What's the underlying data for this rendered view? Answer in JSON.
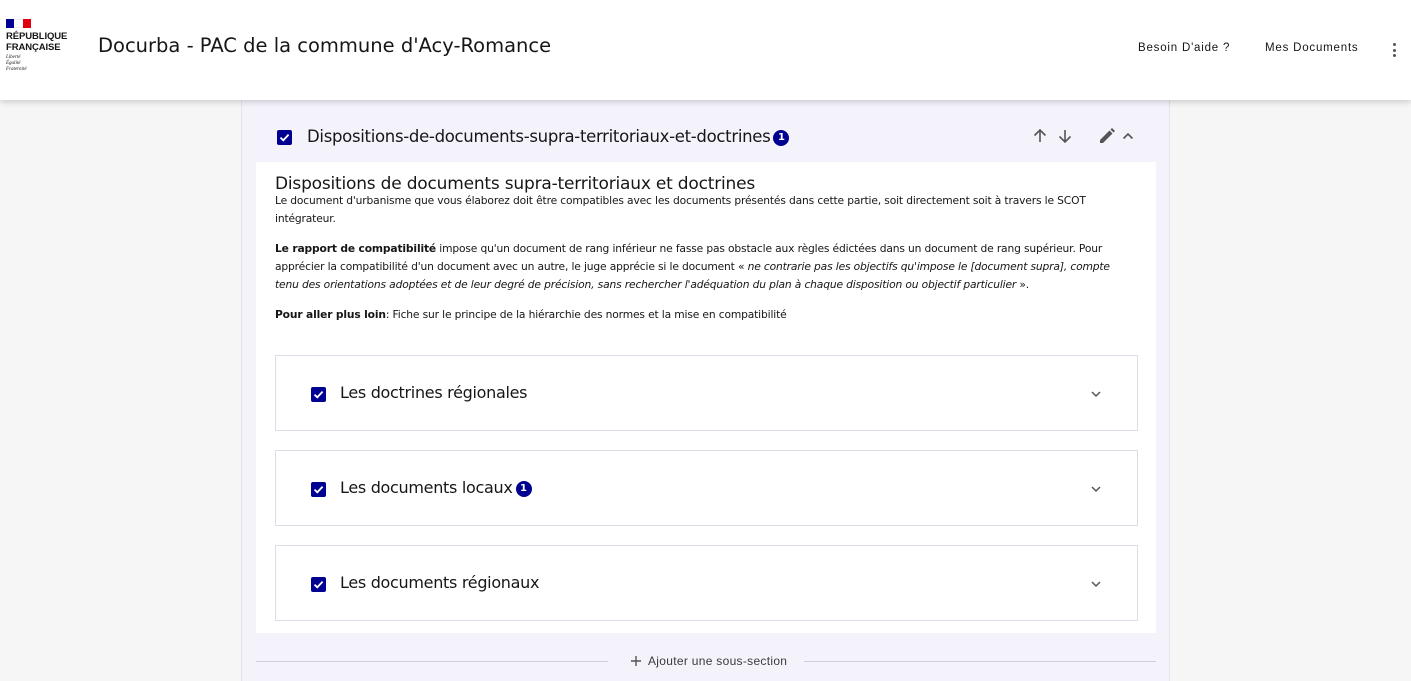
{
  "header": {
    "logo_lines": [
      "RÉPUBLIQUE",
      "FRANÇAISE"
    ],
    "logo_motto": [
      "Liberté",
      "Égalité",
      "Fraternité"
    ],
    "app_title": "Docurba - PAC de la commune d'Acy-Romance",
    "help_link": "Besoin D'aide ?",
    "documents_link": "Mes Documents",
    "menu_icon": "dots-vertical-icon"
  },
  "section": {
    "title": "Dispositions-de-documents-supra-territoriaux-et-doctrines",
    "badge": "1",
    "checked": true,
    "actions": [
      "arrow-up-icon",
      "arrow-down-icon",
      "pencil-icon",
      "chevron-up-icon"
    ]
  },
  "content": {
    "heading": "Dispositions de documents supra-territoriaux et doctrines",
    "intro": "Le document d'urbanisme que vous élaborez doit être compatibles avec les documents présentés dans cette partie, soit directement soit à travers le SCOT intégrateur.",
    "compat_label": "Le rapport de compatibilité",
    "compat_text": " impose qu'un document de rang inférieur ne fasse pas obstacle aux règles édictées dans un document de rang supérieur. Pour apprécier la compatibilité d'un document avec un autre, le juge apprécie si le document « ",
    "compat_quote": "ne contrarie pas les objectifs qu'impose le [document supra], compte tenu des orientations adoptées et de leur degré de précision, sans rechercher l'adéquation du plan à chaque disposition ou objectif particulier",
    "compat_end": " ».",
    "further_label": "Pour aller plus loin",
    "further_text": ": Fiche sur le principe de la hiérarchie des normes et la mise en compatibilité"
  },
  "subsections": [
    {
      "title": "Les doctrines régionales",
      "badge": "",
      "checked": true
    },
    {
      "title": "Les documents locaux",
      "badge": "1",
      "checked": true
    },
    {
      "title": "Les documents régionaux",
      "badge": "",
      "checked": true
    }
  ],
  "add_subsection_label": "Ajouter une sous-section",
  "colors": {
    "accent": "#000091",
    "flag_blue": "#000091",
    "flag_white": "#ffffff",
    "flag_red": "#e1000f",
    "panel_bg": "#f4f3fb"
  }
}
